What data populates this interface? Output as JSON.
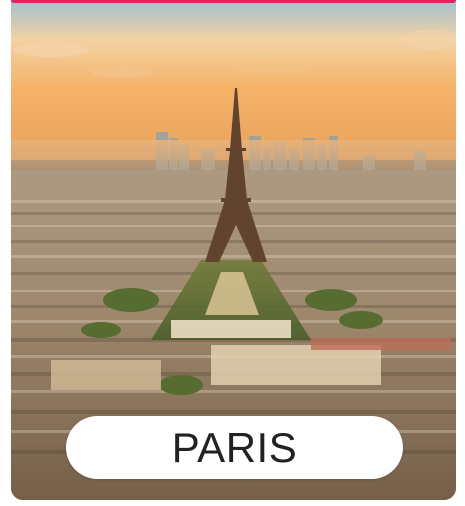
{
  "destination": {
    "name": "PARIS",
    "image_subject": "eiffel-tower-skyline-photo"
  },
  "colors": {
    "accent": "#e0245e",
    "label_bg": "#ffffff",
    "label_text": "#222222"
  }
}
